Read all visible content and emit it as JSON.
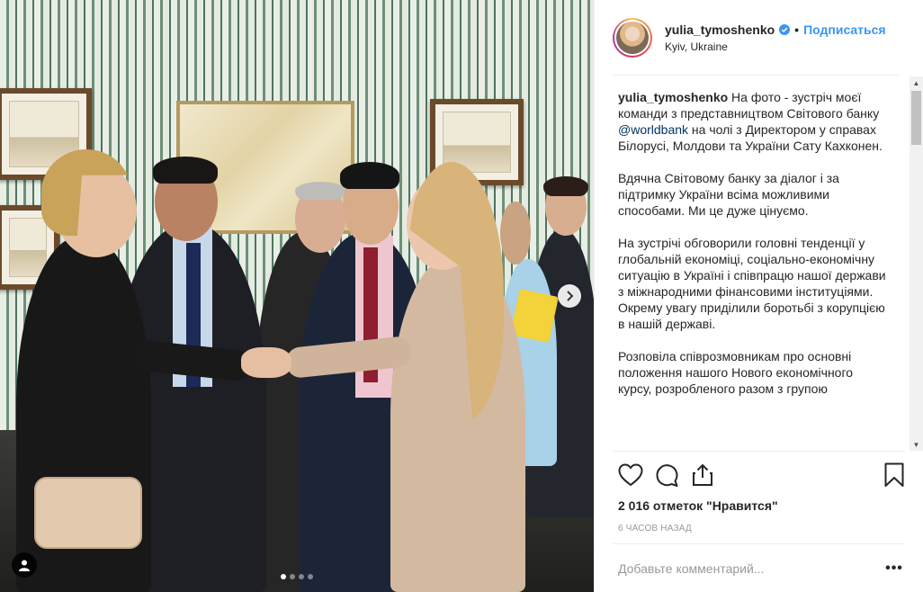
{
  "post": {
    "username": "yulia_tymoshenko",
    "follow_label": "Подписаться",
    "separator": "•",
    "location": "Kyiv, Ukraine",
    "caption": {
      "username": "yulia_tymoshenko",
      "p1_before": " На фото - зустріч моєї команди з представництвом Світового банку ",
      "p1_mention": "@worldbank",
      "p1_after": " на чолі з Директором у справах Білорусі, Молдови та України Сату Кахконен.",
      "p2": "Вдячна Світовому банку за діалог і за підтримку України всіма можливими способами. Ми це дуже цінуємо.",
      "p3": "На зустрічі обговорили головні тенденції у глобальній економіці, соціально-економічну ситуацію в Україні і співпрацю нашої держави з міжнародними фінансовими інституціями. Окрему увагу приділили боротьбі з корупцією в нашій державі.",
      "p4": "Розповіла співрозмовникам про основні положення нашого Нового економічного курсу, розробленого разом з групою"
    },
    "likes_text": "2 016 отметок \"Нравится\"",
    "time_text": "6 часов назад",
    "comment_placeholder": "Добавьте комментарий...",
    "more_label": "•••"
  },
  "media": {
    "carousel": {
      "total": 4,
      "active": 1
    }
  },
  "icons": {
    "verified": "verified-badge-icon",
    "like": "heart-icon",
    "comment": "comment-bubble-icon",
    "share": "share-icon",
    "save": "bookmark-icon",
    "next": "chevron-right-icon",
    "tags": "user-tag-icon"
  },
  "colors": {
    "link": "#3897f0",
    "mention": "#003569",
    "muted": "#999999"
  }
}
